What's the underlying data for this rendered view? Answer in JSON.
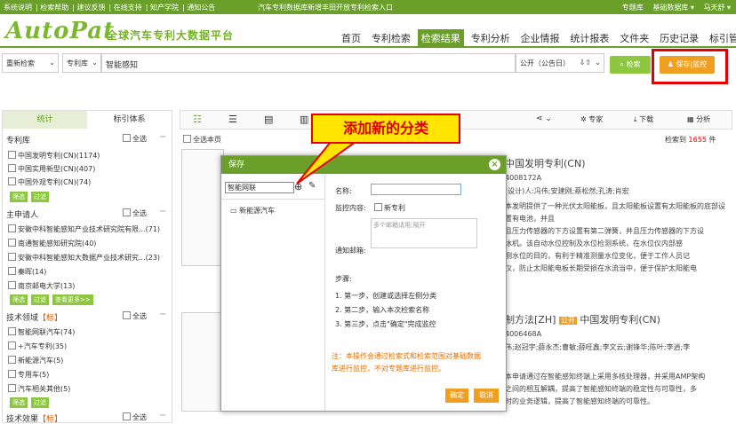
{
  "topbar": {
    "links": [
      "系统说明",
      "检索帮助",
      "建议反馈",
      "在线支持",
      "知产学院",
      "通知公告"
    ],
    "notice": "汽车专利数据库新增丰田开放专利检索入口",
    "right": [
      "专题库",
      "基础数据库 ▾",
      "马天舒 ▾"
    ]
  },
  "logo": {
    "text": "AutoPat",
    "sub": "全球汽车专利大数据平台"
  },
  "nav": [
    "首页",
    "专利检索",
    "检索结果",
    "专利分析",
    "企业情报",
    "统计报表",
    "文件夹",
    "历史记录",
    "标引管理"
  ],
  "nav_active": 2,
  "search": {
    "mode": "重新检索",
    "library": "专利库",
    "query": "智能感知",
    "sort": "公开（公告日）",
    "sort_arrows": "⇩⇧",
    "search_btn": "检索",
    "save_btn": "保存|监控"
  },
  "left": {
    "tab_stats": "统计",
    "tab_index": "标引体系",
    "select_all": "全选",
    "sections": [
      {
        "title": "专利库",
        "items": [
          "中国发明专利(CN)(1174)",
          "中国实用新型(CN)(407)",
          "中国外观专利(CN)(74)"
        ]
      },
      {
        "title": "主申请人",
        "items": [
          "安徽中科智能感知产业技术研究院有限...(71)",
          "南通智能感知研究院(40)",
          "安徽中科智能感知大数据产业技术研究...(23)",
          "秦晖(14)",
          "南京邮电大学(13)"
        ]
      },
      {
        "title": "技术领域",
        "tag": "【标】",
        "items": [
          "智能网联汽车(74)",
          "+汽车专利(35)",
          "新能源汽车(5)",
          "专用车(5)",
          "汽车相关其他(5)"
        ]
      },
      {
        "title": "技术效果",
        "tag": "【标】",
        "items": []
      }
    ],
    "filter": "筛选",
    "exclude": "过滤",
    "more": "查看更多>>"
  },
  "toolbar": {
    "expert": "专家",
    "download": "下载",
    "analysis": "分析",
    "select_page": "全选本页"
  },
  "results": {
    "prefix": "检索到",
    "count": "1655",
    "suffix": "件"
  },
  "bg": {
    "r1_title": "中国发明专利(CN)",
    "r1_no": "4008172A",
    "r1_inv": "(设计)人:冯伟;安建刚;蔡松然;孔涛;肖宏",
    "r1_p1": "本发明提供了一种光伏太阳能板，且太阳能板设置有太阳能板的底部设置有电池，并且",
    "r1_p2": "且压力传感器的下方设置有第二弹簧，并且压力传感器的下方设",
    "r1_p3": "冰机。该自动水位控制及水位检测系统，在水位仪内部感",
    "r1_p4": "测水位的目的，有利于精准测量水位变化，便于工作人员记",
    "r1_p5": "仪，防止太阳能电板长期受损在水流当中，便于保护太阳能电",
    "r2_title": "制方法[ZH]",
    "r2_tag": "公开",
    "r2_title2": "中国发明专利(CN)",
    "r2_no": "4006468A",
    "r2_inv": "伟;赵冠宇;薛永杰;曹敏;薛旺鑫;李文云;谢锋华;陈叶;李逍;李",
    "r2_p1": "本申请通过在智能感知终端上采用多核处理器，并采用AMP架构",
    "r2_p2": "之间的相互解耦，提高了智能感知终端的稳定性与可靠性，多",
    "r2_p3": "时的业务逻辑，提高了智能感知终端的可靠性。"
  },
  "modal": {
    "title": "保存",
    "folder_input": "智能网联",
    "folder_name": "新能源汽车",
    "name_label": "名称:",
    "monitor_label": "监控内容:",
    "new_patent": "新专利",
    "email_label": "通知邮箱:",
    "email_placeholder": "多个邮箱请用;隔开",
    "steps_title": "步骤:",
    "step1": "1. 第一步，创建或选择左侧分类",
    "step2": "2. 第二步，输入本次检索名称",
    "step3": "3. 第三步，点击\"确定\"完成监控",
    "note1": "注：本操作会通过检索式和检索范围对基础数据",
    "note2": "库进行监控，不对专题库进行监控。",
    "ok": "确定",
    "cancel": "取消"
  },
  "callout": "添加新的分类",
  "colors": {
    "green": "#6a9f2a",
    "light_green": "#8dc63f",
    "orange": "#f0a020",
    "red": "#e60000",
    "callout_yellow": "#ffe500"
  }
}
